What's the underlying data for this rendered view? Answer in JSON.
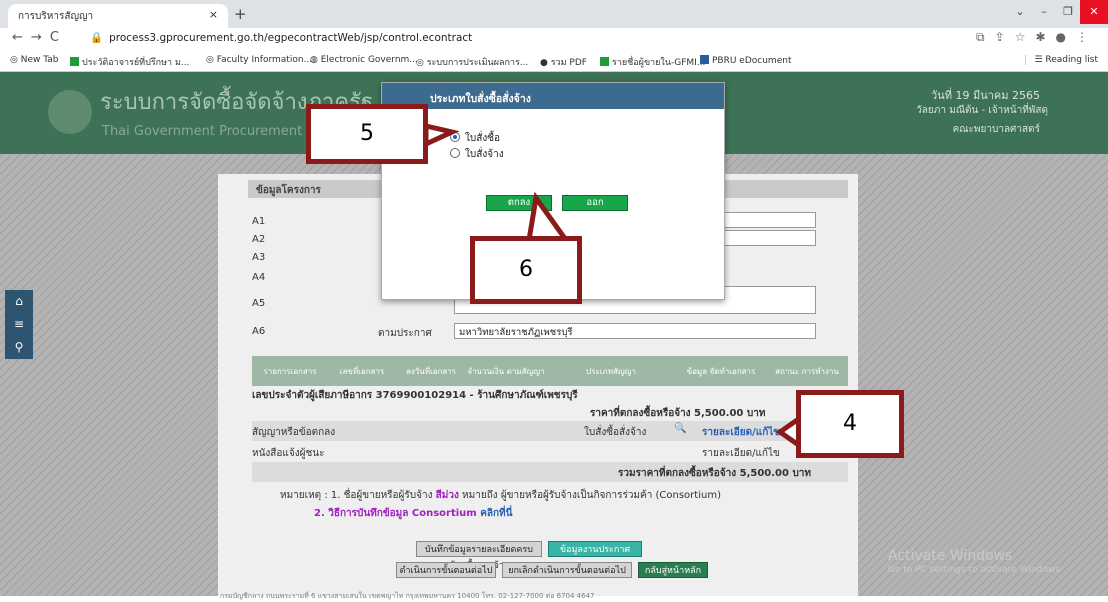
{
  "browser": {
    "tab_title": "การบริหารสัญญา",
    "tab_close": "×",
    "new_tab": "+",
    "url": "process3.gprocurement.go.th/egpecontractWeb/jsp/control.econtract",
    "bookmarks": [
      "New Tab",
      "ประวัติอาจารย์ที่ปรึกษา ม...",
      "Faculty Information...",
      "Electronic Governm...",
      "ระบบการประเมินผลการ...",
      "รวม PDF",
      "รายชื่อผู้ขายใน-GFMI...",
      "PBRU eDocument"
    ],
    "reading_list": "Reading list"
  },
  "header": {
    "title": "ระบบการจัดซื้อจัดจ้างภาครัฐ",
    "subtitle": "Thai Government Procurement",
    "date": "วันที่ 19 มีนาคม 2565",
    "user": "วัลยภา มณีต้น - เจ้าหน้าที่พัสดุ",
    "dept": "คณะพยาบาลศาสตร์"
  },
  "form": {
    "section_title": "ข้อมูลโครงการ",
    "rows": [
      {
        "code": "A1",
        "caption": "",
        "value": ""
      },
      {
        "code": "A2",
        "caption": "",
        "value": ""
      },
      {
        "code": "A3",
        "caption": "",
        "value": ""
      },
      {
        "code": "A4",
        "caption": "",
        "value": ""
      },
      {
        "code": "A5",
        "caption": "",
        "value": ""
      },
      {
        "code": "A6",
        "caption": "ตามประกาศ",
        "value": "มหาวิทยาลัยราชภัฏเพชรบุรี"
      }
    ],
    "table_headers": [
      "รายการเอกสาร",
      "เลขที่เอกสาร",
      "ลงวันที่เอกสาร",
      "จำนวนเงิน ตามสัญญา",
      "ประเภทสัญญา",
      "ข้อมูล จัดทำเอกสาร",
      "สถานะ การทำงาน"
    ],
    "vendor": "เลขประจำตัวผู้เสียภาษีอากร 3769900102914 - ร้านศึกษาภัณฑ์เพชรบุรี",
    "price_line": "ราคาที่ตกลงซื้อหรือจ้าง 5,500.00 บาท",
    "contract_label": "สัญญาหรือข้อตกลง",
    "contract_type": "ใบสั่งซื้อสั่งจ้าง",
    "detail_link": "รายละเอียด/แก้ไข",
    "winner_label": "หนังสือแจ้งผู้ชนะ",
    "winner_link": "รายละเอียด/แก้ไข",
    "total": "รวมราคาที่ตกลงซื้อหรือจ้าง 5,500.00 บาท",
    "note1_a": "หมายเหตุ : 1. ชื่อผู้ขายหรือผู้รับจ้าง ",
    "note1_b": "สีม่วง",
    "note1_c": " หมายถึง ผู้ขายหรือผู้รับจ้างเป็นกิจการร่วมค้า (Consortium)",
    "note2_a": "2. วิธีการบันทึกข้อมูล Consortium ",
    "note2_b": "คลิกที่นี่",
    "buttons": [
      "บันทึกข้อมูลรายละเอียดครบถ้วนซื้อรวมจ้าง",
      "ข้อมูลงานประกาศโครงการ",
      "ดำเนินการขั้นตอนต่อไป",
      "ยกเลิกดำเนินการขั้นตอนต่อไป",
      "กลับสู่หน้าหลัก"
    ],
    "footer": "กรมบัญชีกลาง ถนนพระรามที่ 6 แขวงสามเสนใน เขตพญาไท กรุงเทพมหานคร 10400 โทร. 02-127-7000 ต่อ 6704 4647"
  },
  "dialog": {
    "title": "ประเภทใบสั่งซื้อสั่งจ้าง",
    "options": [
      "ใบสั่งซื้อ",
      "ใบสั่งจ้าง"
    ],
    "selected": "ใบสั่งซื้อ",
    "ok": "ตกลง",
    "exit": "ออก"
  },
  "callouts": [
    "5",
    "6",
    "4"
  ],
  "watermark": {
    "line1": "Activate Windows",
    "line2": "Go to PC settings to activate Windows."
  },
  "colors": {
    "header_green": "#3d7257",
    "callout_border": "#8b1a1a",
    "dialog_header": "#3d6a8f",
    "ok_green": "#17a64a"
  }
}
